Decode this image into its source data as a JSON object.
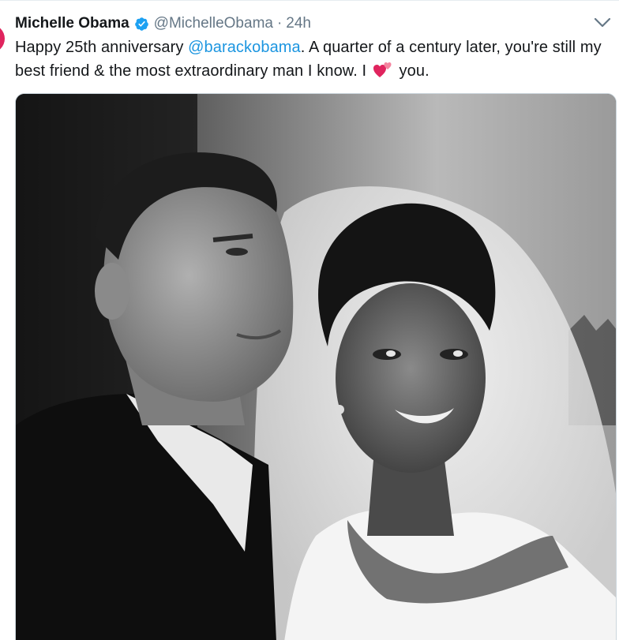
{
  "tweet": {
    "display_name": "Michelle Obama",
    "handle": "@MichelleObama",
    "separator": "·",
    "timestamp": "24h",
    "text_part1": "Happy 25th anniversary ",
    "mention": "@barackobama",
    "text_part2": ". A quarter of a century later, you're still my best friend & the most extraordinary man I know. I ",
    "text_part3": " you.",
    "emoji": "two-hearts-icon",
    "verified_icon": "verified-badge-icon",
    "menu_icon": "chevron-down-icon",
    "colors": {
      "name": "#14171a",
      "secondary": "#657786",
      "link": "#1b95e0",
      "verified": "#1da1f2",
      "heart": "#e0245e"
    }
  }
}
